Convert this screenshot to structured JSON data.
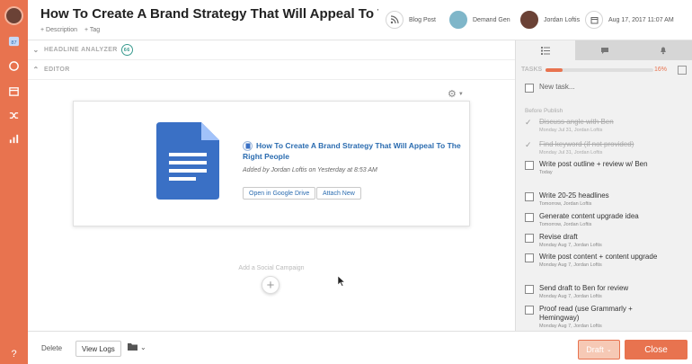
{
  "header": {
    "title": "How To Create A Brand Strategy That Will Appeal To The R",
    "add_description": "+ Description",
    "add_tag": "+ Tag",
    "post_type": "Blog Post",
    "campaign": "Demand Gen",
    "author": "Jordan Loftis",
    "date": "Aug 17, 2017 11:07 AM"
  },
  "sections": {
    "headline_analyzer": "HEADLINE ANALYZER",
    "headline_score": "66",
    "editor": "EDITOR"
  },
  "doc_card": {
    "title": "How To Create A Brand Strategy That Will Appeal To The Right People",
    "meta": "Added by Jordan Loftis on Yesterday at 8:53 AM",
    "open_button": "Open in Google Drive",
    "attach_button": "Attach New",
    "doc_color": "#3a70c5"
  },
  "social": {
    "label": "Add a Social Campaign"
  },
  "tasks_panel": {
    "label": "TASKS",
    "percent_text": "16%",
    "progress": 0.16,
    "new_task_placeholder": "New task...",
    "group_label": "Before Publish",
    "items": [
      {
        "text": "Discuss angle with Ben",
        "meta": "Monday Jul 31, Jordan Loftis",
        "done": true
      },
      {
        "text": "Find keyword (if not provided)",
        "meta": "Monday Jul 31, Jordan Loftis",
        "done": true
      },
      {
        "text": "Write post outline + review w/ Ben",
        "meta": "Today",
        "done": false
      },
      {
        "text": "Write 20-25 headlines",
        "meta": "Tomorrow, Jordan Loftis",
        "done": false
      },
      {
        "text": "Generate content upgrade idea",
        "meta": "Tomorrow, Jordan Loftis",
        "done": false
      },
      {
        "text": "Revise draft",
        "meta": "Monday Aug 7, Jordan Loftis",
        "done": false
      },
      {
        "text": "Write post content + content upgrade",
        "meta": "Monday Aug 7, Jordan Loftis",
        "done": false
      },
      {
        "text": "Send draft to Ben for review",
        "meta": "Monday Aug 7, Jordan Loftis",
        "done": false
      },
      {
        "text": "Proof read (use Grammarly + Hemingway)",
        "meta": "Monday Aug 7, Jordan Loftis",
        "done": false
      }
    ]
  },
  "footer": {
    "delete": "Delete",
    "view_logs": "View Logs",
    "draft": "Draft",
    "close": "Close"
  },
  "rail": {
    "help": "?"
  },
  "colors": {
    "accent": "#e8734f",
    "link": "#2b6cb0"
  }
}
